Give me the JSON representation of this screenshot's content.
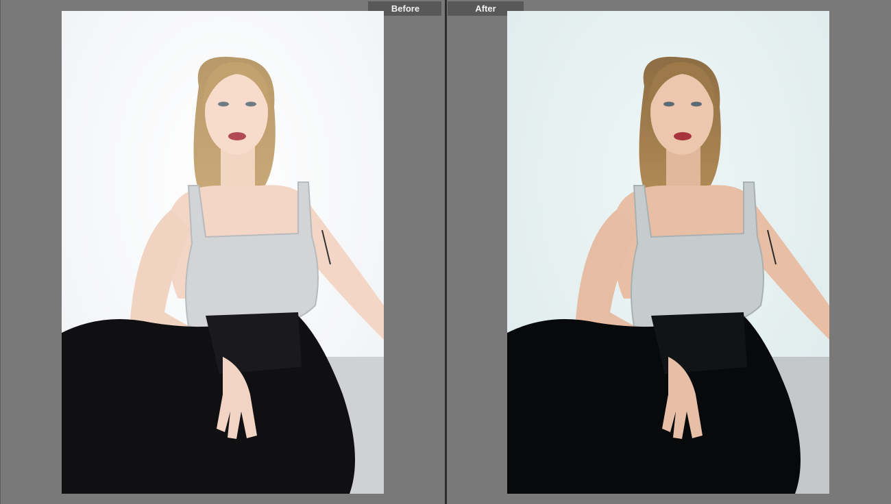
{
  "labels": {
    "before": "Before",
    "after": "After"
  },
  "colors": {
    "workspace_bg": "#7a7a7a",
    "label_bg": "#585858",
    "label_text": "#f2f2f2",
    "divider": "#2b2b2b",
    "before_bg": "#fbfcfd",
    "after_bg": "#e6f1f1"
  },
  "photos": {
    "before": {
      "subject": "portrait-photo",
      "tone": "original"
    },
    "after": {
      "subject": "portrait-photo",
      "tone": "edited"
    }
  }
}
